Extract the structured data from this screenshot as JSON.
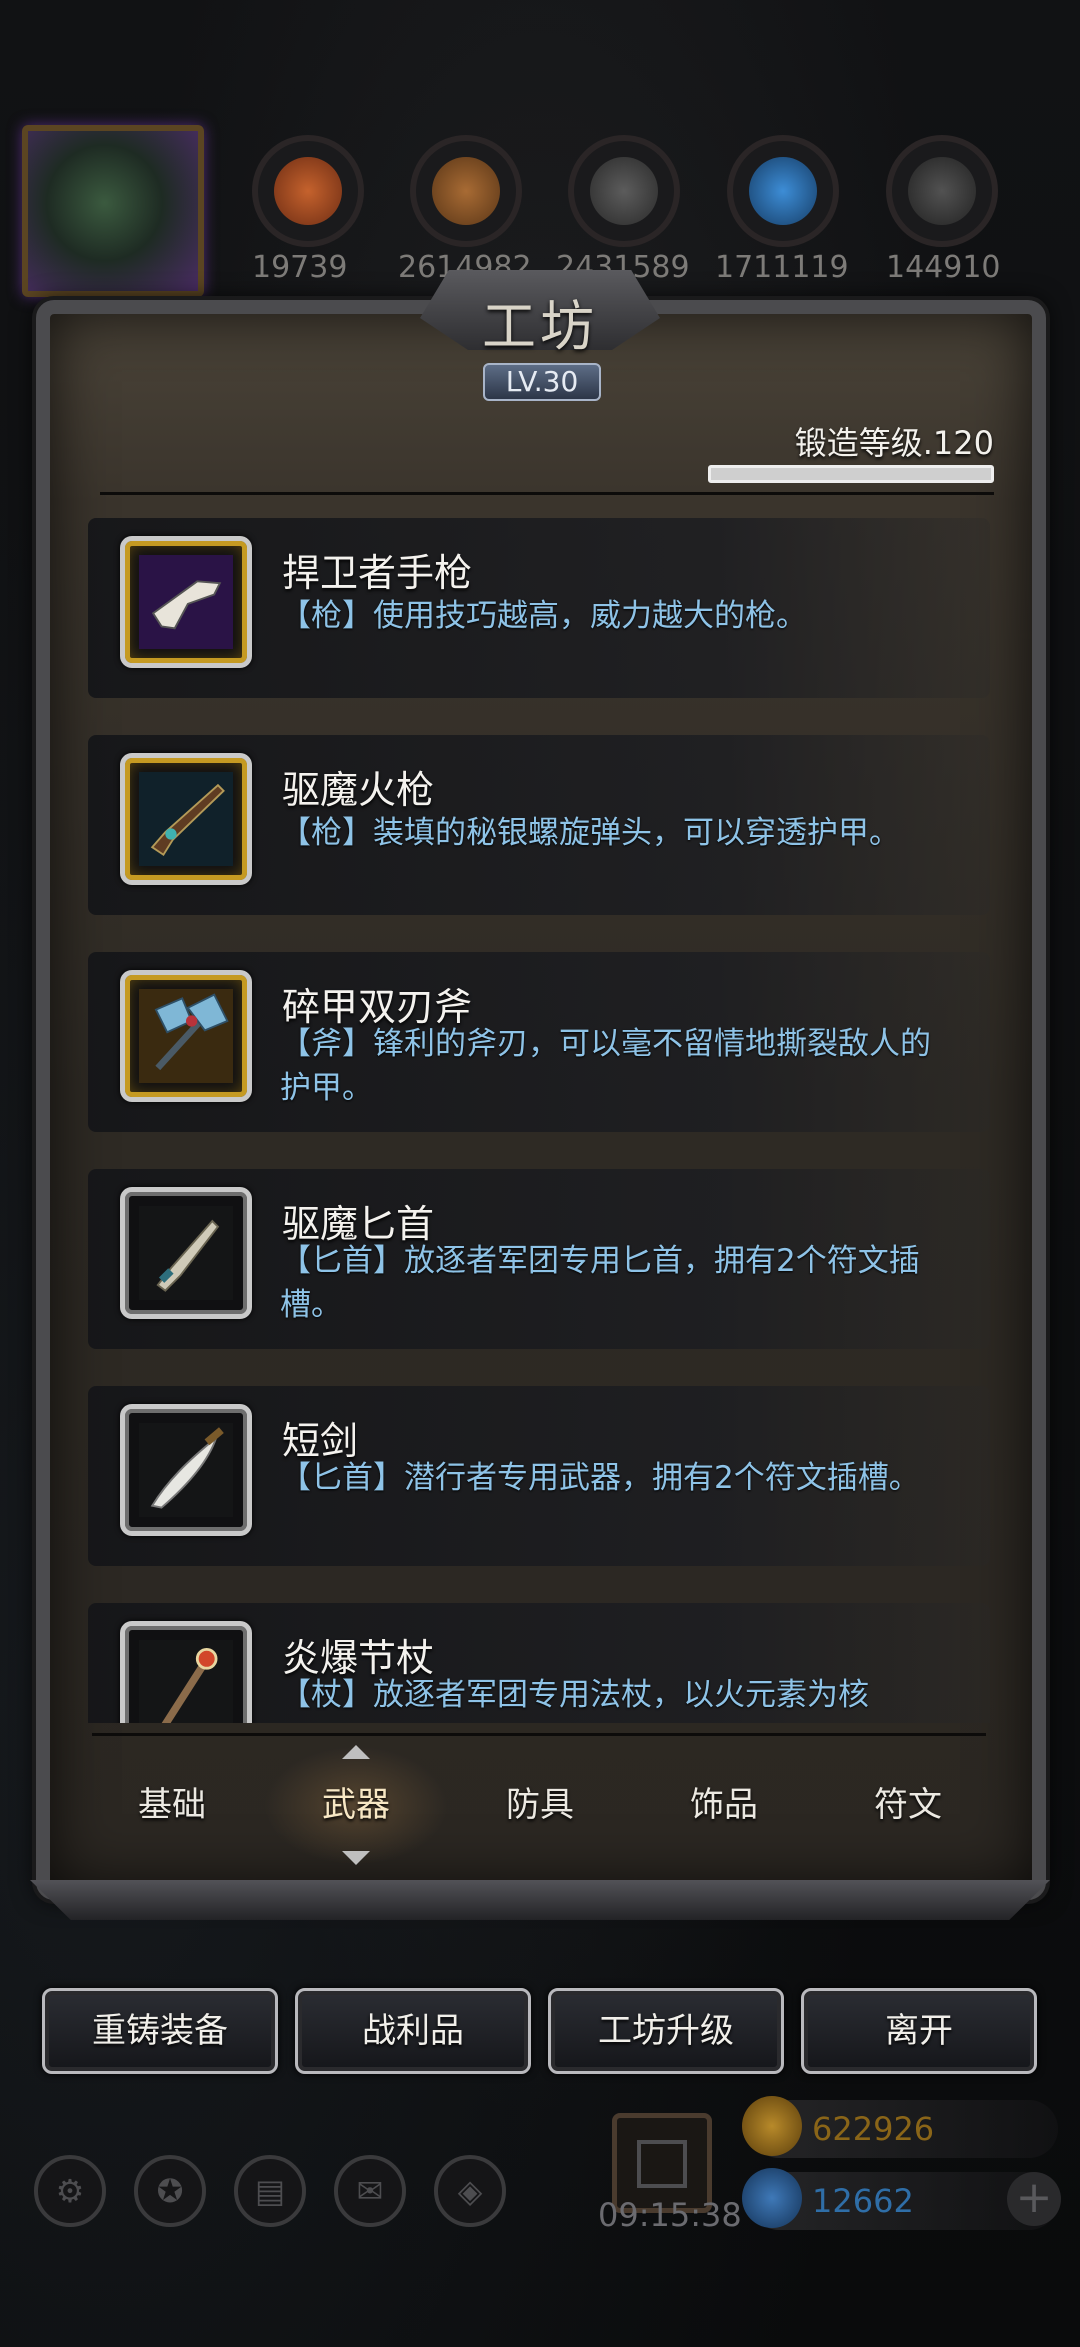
{
  "top_bar": {
    "resources": [
      {
        "icon": "ore-icon",
        "value": "19739"
      },
      {
        "icon": "wood-icon",
        "value": "2614982"
      },
      {
        "icon": "iron-icon",
        "value": "2431589"
      },
      {
        "icon": "crystal-icon",
        "value": "1711119"
      },
      {
        "icon": "stone-icon",
        "value": "144910"
      }
    ]
  },
  "panel": {
    "title": "工坊",
    "level": "LV.30",
    "forge_level_text": "锻造等级.120",
    "forge_progress": 1.0
  },
  "items": [
    {
      "name": "捍卫者手枪",
      "desc": "【枪】使用技巧越高，威力越大的枪。",
      "icon": "pistol-icon",
      "frame": "gold"
    },
    {
      "name": "驱魔火枪",
      "desc": "【枪】装填的秘银螺旋弹头，可以穿透护甲。",
      "icon": "musket-icon",
      "frame": "gold"
    },
    {
      "name": "碎甲双刃斧",
      "desc": "【斧】锋利的斧刃，可以毫不留情地撕裂敌人的护甲。",
      "icon": "double-axe-icon",
      "frame": "gold"
    },
    {
      "name": "驱魔匕首",
      "desc": "【匕首】放逐者军团专用匕首，拥有2个符文插槽。",
      "icon": "dagger-icon",
      "frame": "silver"
    },
    {
      "name": "短剑",
      "desc": "【匕首】潜行者专用武器，拥有2个符文插槽。",
      "icon": "short-sword-icon",
      "frame": "silver"
    },
    {
      "name": "炎爆节杖",
      "desc": "【杖】放逐者军团专用法杖，以火元素为核",
      "icon": "staff-icon",
      "frame": "silver"
    }
  ],
  "tabs": [
    "基础",
    "武器",
    "防具",
    "饰品",
    "符文"
  ],
  "active_tab": "武器",
  "actions": [
    "重铸装备",
    "战利品",
    "工坊升级",
    "离开"
  ],
  "hud": {
    "timer": "09:15:38",
    "gold": "622926",
    "gems": "12662",
    "plus": "+",
    "colors": {
      "gold_text": "#8a6518",
      "gem_text": "#2f6ea7",
      "desc_text": "#8ec3e7"
    }
  }
}
